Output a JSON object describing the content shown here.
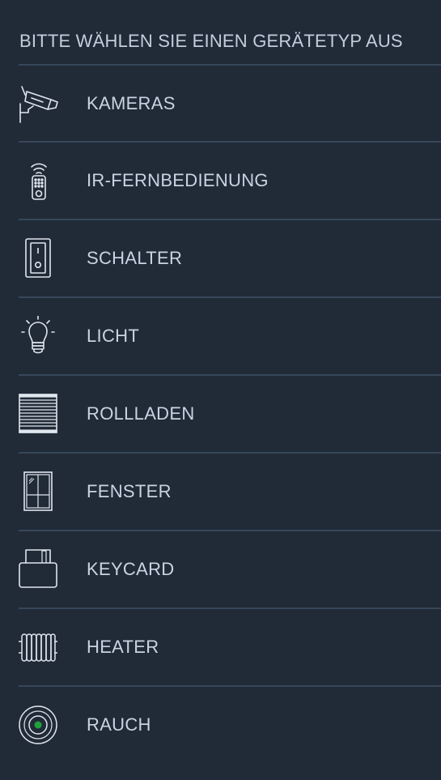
{
  "header": {
    "title": "BITTE WÄHLEN SIE EINEN GERÄTETYP AUS"
  },
  "device_types": [
    {
      "label": "KAMERAS",
      "icon": "camera-icon"
    },
    {
      "label": "IR-FERNBEDIENUNG",
      "icon": "remote-control-icon"
    },
    {
      "label": "SCHALTER",
      "icon": "switch-icon"
    },
    {
      "label": "LICHT",
      "icon": "lightbulb-icon"
    },
    {
      "label": "ROLLLADEN",
      "icon": "roller-shutter-icon"
    },
    {
      "label": "FENSTER",
      "icon": "window-icon"
    },
    {
      "label": "KEYCARD",
      "icon": "keycard-icon"
    },
    {
      "label": "HEATER",
      "icon": "radiator-icon"
    },
    {
      "label": "RAUCH",
      "icon": "smoke-detector-icon"
    }
  ],
  "colors": {
    "background": "#212a37",
    "divider": "#37475a",
    "text": "#c9d4e2",
    "icon_stroke": "#dfe6ee",
    "smoke_led": "#1fa23a"
  }
}
